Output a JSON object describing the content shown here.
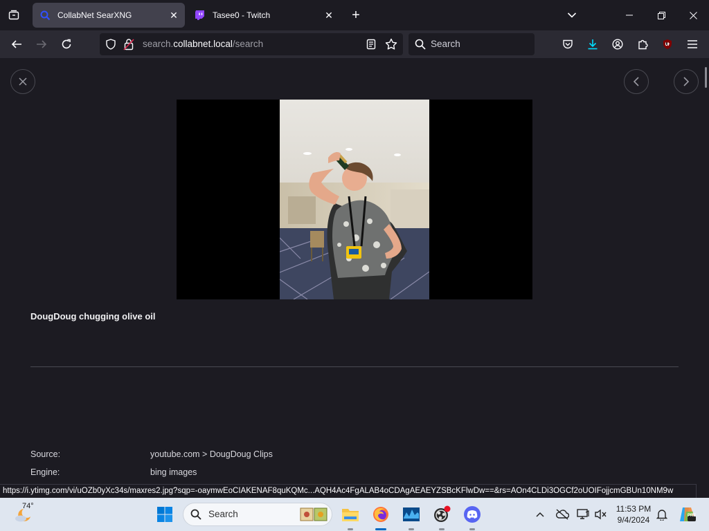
{
  "tabs": [
    {
      "title": "CollabNet SearXNG",
      "active": true
    },
    {
      "title": "Tasee0 - Twitch",
      "active": false
    }
  ],
  "urlbar": {
    "domain_prefix": "search.",
    "domain": "collabnet.local",
    "path": "/search"
  },
  "searchbar": {
    "placeholder": "Search"
  },
  "result": {
    "title": "DougDoug chugging olive oil",
    "meta": [
      {
        "label": "Source:",
        "value": "youtube.com > DougDoug Clips"
      },
      {
        "label": "Engine:",
        "value": "bing images"
      }
    ]
  },
  "status_url": "https://i.ytimg.com/vi/uOZb0yXc34s/maxres2.jpg?sqp=-oaymwEoCIAKENAF8quKqQMcGADwAQH4AbYIgAKAD4oCDAgAEAEYZSBcKFIwDw==&rs=AOn4CLDi3OGCf2oUOIFojjcmGBUn10NM9w",
  "status_url_display": "https://i.ytimg.com/vi/uOZb0yXc34s/maxres2.jpg?sqp=-oaymwEoCIAKENAF8quKQMc...AQH4Ac4FgALAB4oCDAgAEAEYZSBcKFlwDw==&rs=AOn4CLDi3OGCf2oUOIFojjcmGBUn10NM9w",
  "taskbar": {
    "weather_temp": "74°",
    "search_label": "Search",
    "time": "11:53 PM",
    "date": "9/4/2024"
  },
  "colors": {
    "accent": "#0061e0",
    "chrome_bg": "#1c1b22",
    "toolbar_bg": "#2b2a33",
    "twitch": "#9146ff",
    "download": "#0df"
  }
}
